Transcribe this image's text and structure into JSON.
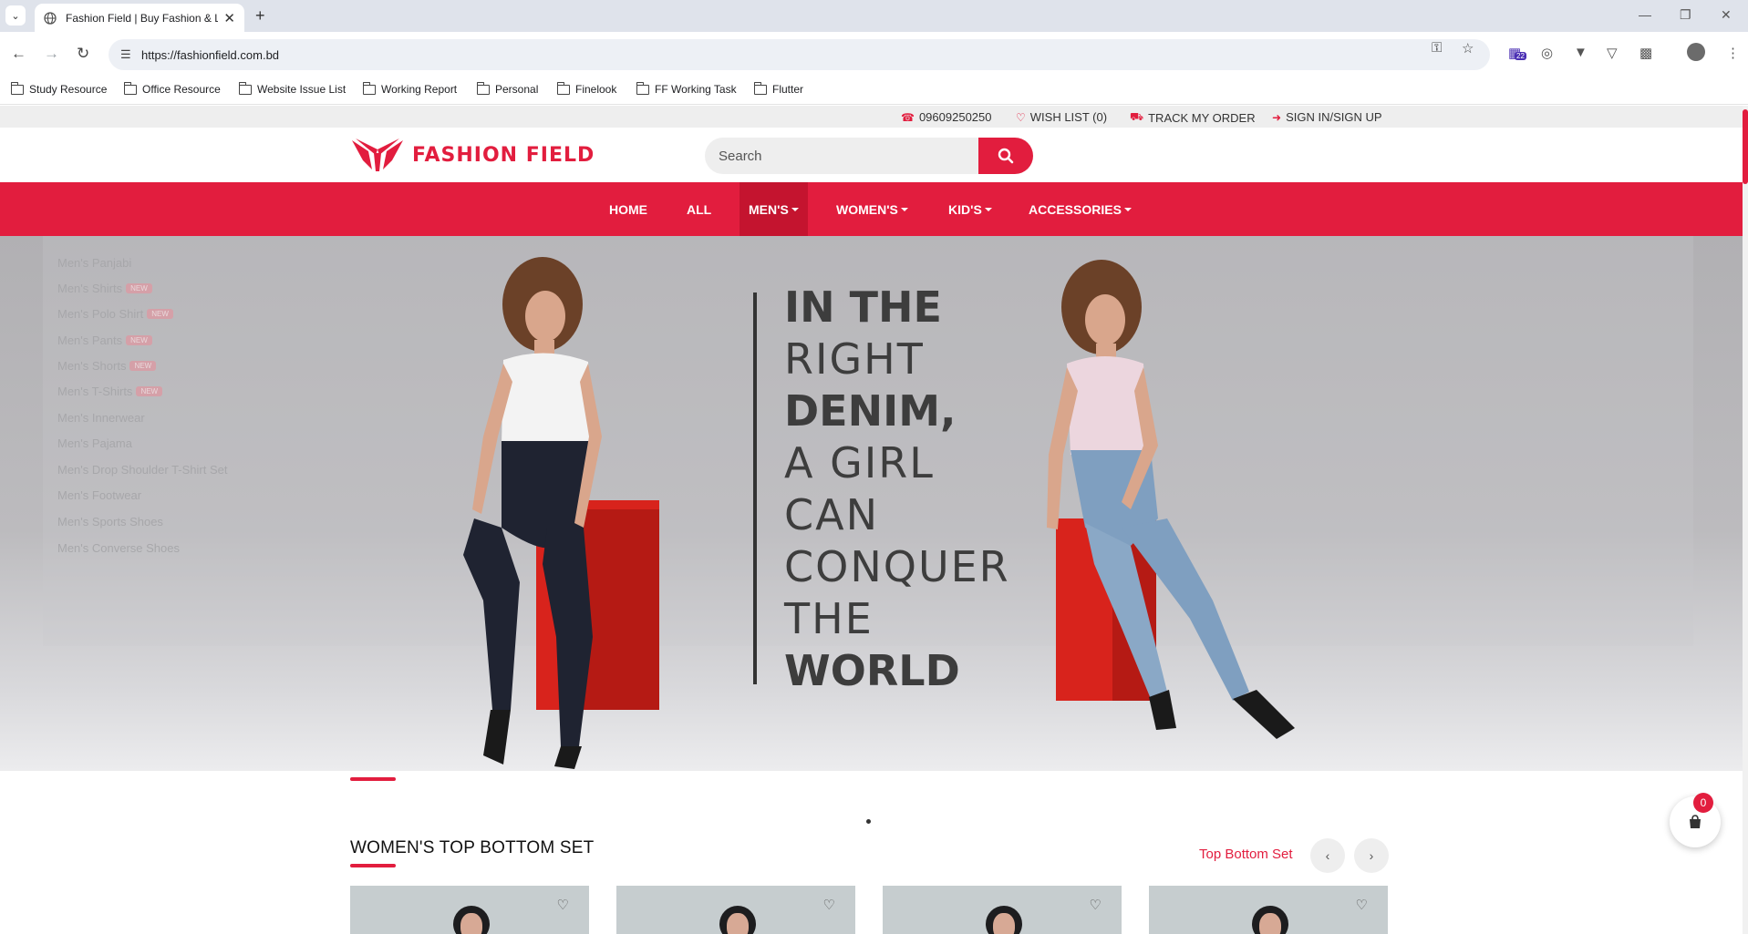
{
  "browser": {
    "tab_title": "Fashion Field | Buy Fashion & Li",
    "url": "https://fashionfield.com.bd",
    "extension_badge": "22",
    "bookmarks": [
      "Study Resource",
      "Office Resource",
      "Website Issue List",
      "Working Report",
      "Personal",
      "Finelook",
      "FF Working Task",
      "Flutter"
    ]
  },
  "topbar": {
    "phone": "09609250250",
    "wishlist": "WISH LIST (0)",
    "track": "TRACK MY ORDER",
    "signin": "SIGN IN/SIGN UP"
  },
  "header": {
    "logo_text": "FASHION FIELD",
    "search_placeholder": "Search"
  },
  "nav": [
    "HOME",
    "ALL",
    "MEN'S",
    "WOMEN'S",
    "KID'S",
    "ACCESSORIES"
  ],
  "dropdown": {
    "items": [
      {
        "label": "Men's Panjabi",
        "badge": "NEW"
      },
      {
        "label": "Men's Shirts",
        "badge": "NEW"
      },
      {
        "label": "Men's Polo Shirt",
        "badge": "NEW"
      },
      {
        "label": "Men's Pants",
        "badge": "NEW"
      },
      {
        "label": "Men's Shorts",
        "badge": "NEW"
      },
      {
        "label": "Men's T-Shirts",
        "badge": "NEW"
      },
      {
        "label": "Men's Innerwear",
        "badge": ""
      },
      {
        "label": "Men's Pajama",
        "badge": ""
      },
      {
        "label": "Men's Drop Shoulder T-Shirt Set",
        "badge": ""
      },
      {
        "label": "Men's Footwear",
        "badge": ""
      },
      {
        "label": "Men's Sports Shoes",
        "badge": ""
      },
      {
        "label": "Men's Converse Shoes",
        "badge": ""
      }
    ]
  },
  "hero": {
    "lines": [
      "IN THE",
      "RIGHT",
      "DENIM,",
      "A GIRL",
      "CAN",
      "CONQUER",
      "THE",
      "WORLD"
    ]
  },
  "section": {
    "title": "WOMEN'S TOP BOTTOM SET",
    "link": "Top Bottom Set"
  },
  "cart": {
    "count": "0"
  },
  "colors": {
    "brand_red": "#e21d3e",
    "nav_active": "#c4142f"
  }
}
